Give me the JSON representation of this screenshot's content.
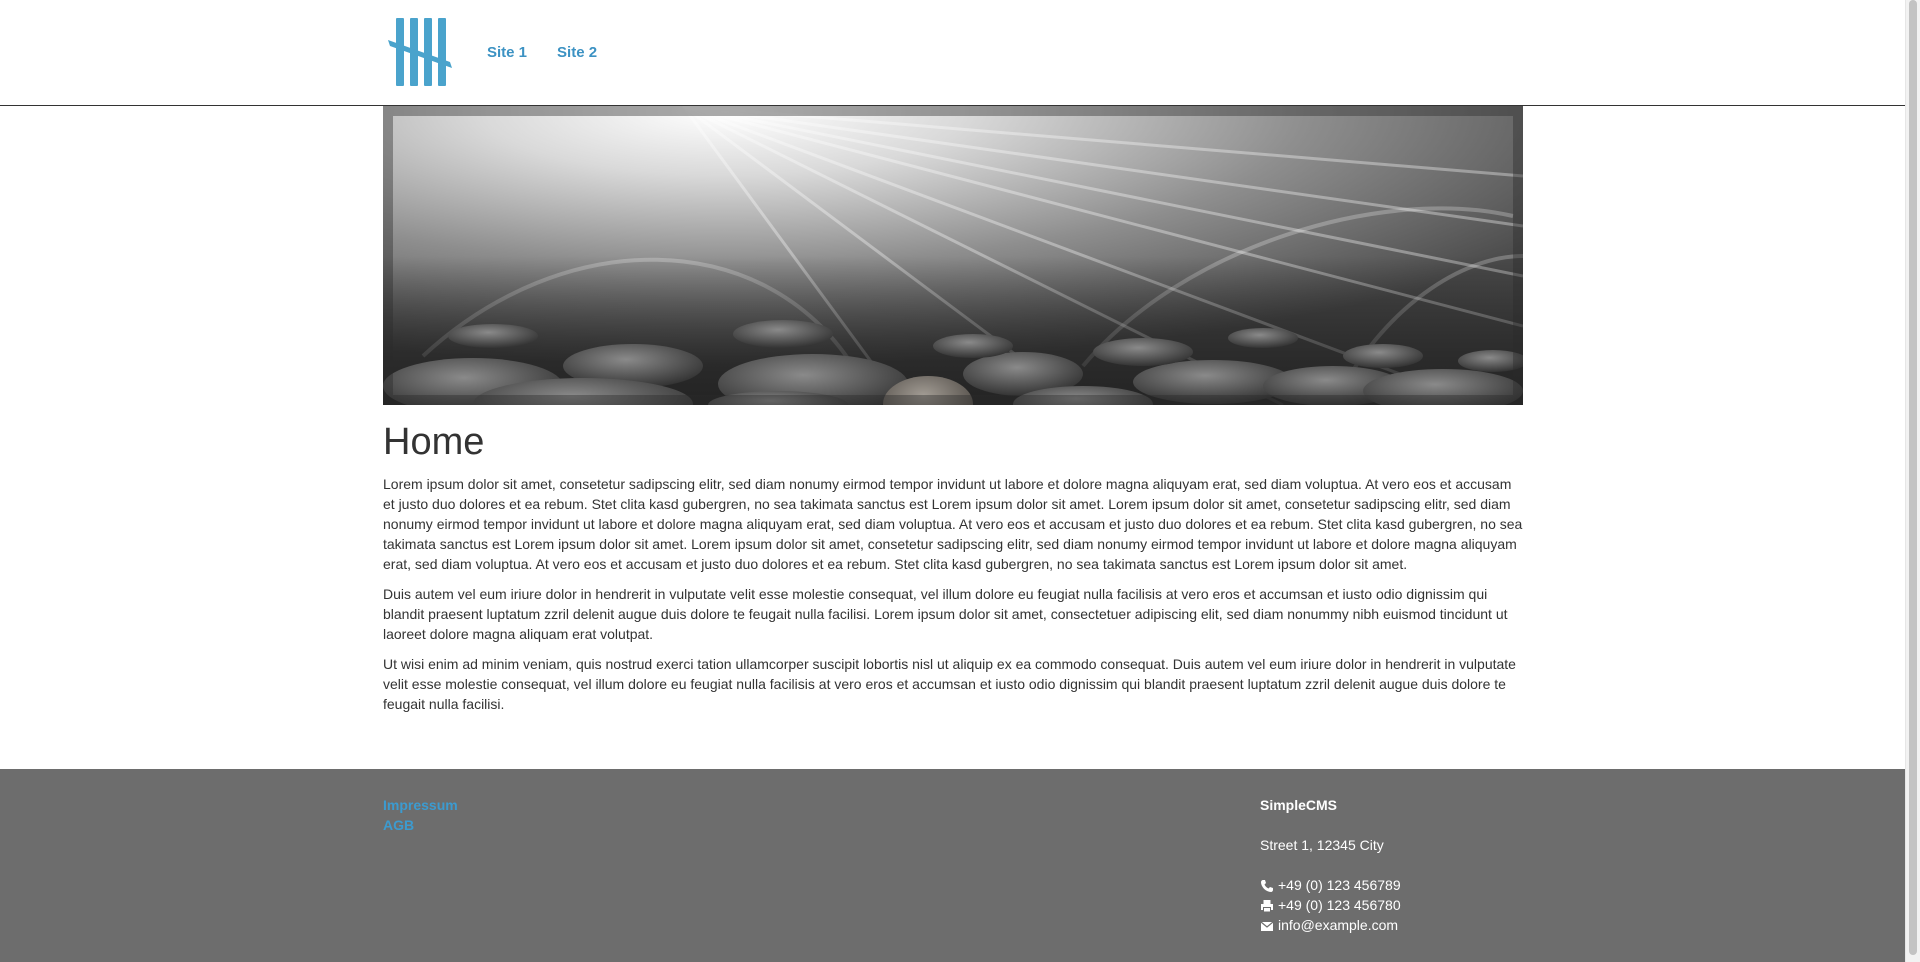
{
  "header": {
    "logo_icon": "tally-marks-logo",
    "logo_color": "#4aa3cc",
    "nav": [
      {
        "label": "Site 1"
      },
      {
        "label": "Site 2"
      }
    ]
  },
  "hero": {
    "image": "pebbles-with-light-rays"
  },
  "main": {
    "title": "Home",
    "paragraphs": [
      "Lorem ipsum dolor sit amet, consetetur sadipscing elitr, sed diam nonumy eirmod tempor invidunt ut labore et dolore magna aliquyam erat, sed diam voluptua. At vero eos et accusam et justo duo dolores et ea rebum. Stet clita kasd gubergren, no sea takimata sanctus est Lorem ipsum dolor sit amet. Lorem ipsum dolor sit amet, consetetur sadipscing elitr, sed diam nonumy eirmod tempor invidunt ut labore et dolore magna aliquyam erat, sed diam voluptua. At vero eos et accusam et justo duo dolores et ea rebum. Stet clita kasd gubergren, no sea takimata sanctus est Lorem ipsum dolor sit amet. Lorem ipsum dolor sit amet, consetetur sadipscing elitr, sed diam nonumy eirmod tempor invidunt ut labore et dolore magna aliquyam erat, sed diam voluptua. At vero eos et accusam et justo duo dolores et ea rebum. Stet clita kasd gubergren, no sea takimata sanctus est Lorem ipsum dolor sit amet.",
      "Duis autem vel eum iriure dolor in hendrerit in vulputate velit esse molestie consequat, vel illum dolore eu feugiat nulla facilisis at vero eros et accumsan et iusto odio dignissim qui blandit praesent luptatum zzril delenit augue duis dolore te feugait nulla facilisi. Lorem ipsum dolor sit amet, consectetuer adipiscing elit, sed diam nonummy nibh euismod tincidunt ut laoreet dolore magna aliquam erat volutpat.",
      "Ut wisi enim ad minim veniam, quis nostrud exerci tation ullamcorper suscipit lobortis nisl ut aliquip ex ea commodo consequat. Duis autem vel eum iriure dolor in hendrerit in vulputate velit esse molestie consequat, vel illum dolore eu feugiat nulla facilisis at vero eros et accumsan et iusto odio dignissim qui blandit praesent luptatum zzril delenit augue duis dolore te feugait nulla facilisi."
    ]
  },
  "footer": {
    "links": [
      {
        "label": "Impressum"
      },
      {
        "label": "AGB"
      }
    ],
    "contact": {
      "company": "SimpleCMS",
      "address": "Street 1, 12345 City",
      "phone": "+49 (0) 123 456789",
      "fax": "+49 (0) 123 456780",
      "email": "info@example.com",
      "phone_icon": "phone-icon",
      "fax_icon": "printer-icon",
      "email_icon": "envelope-icon"
    },
    "background": "#6d6d6d",
    "link_color": "#3c9bd0"
  }
}
